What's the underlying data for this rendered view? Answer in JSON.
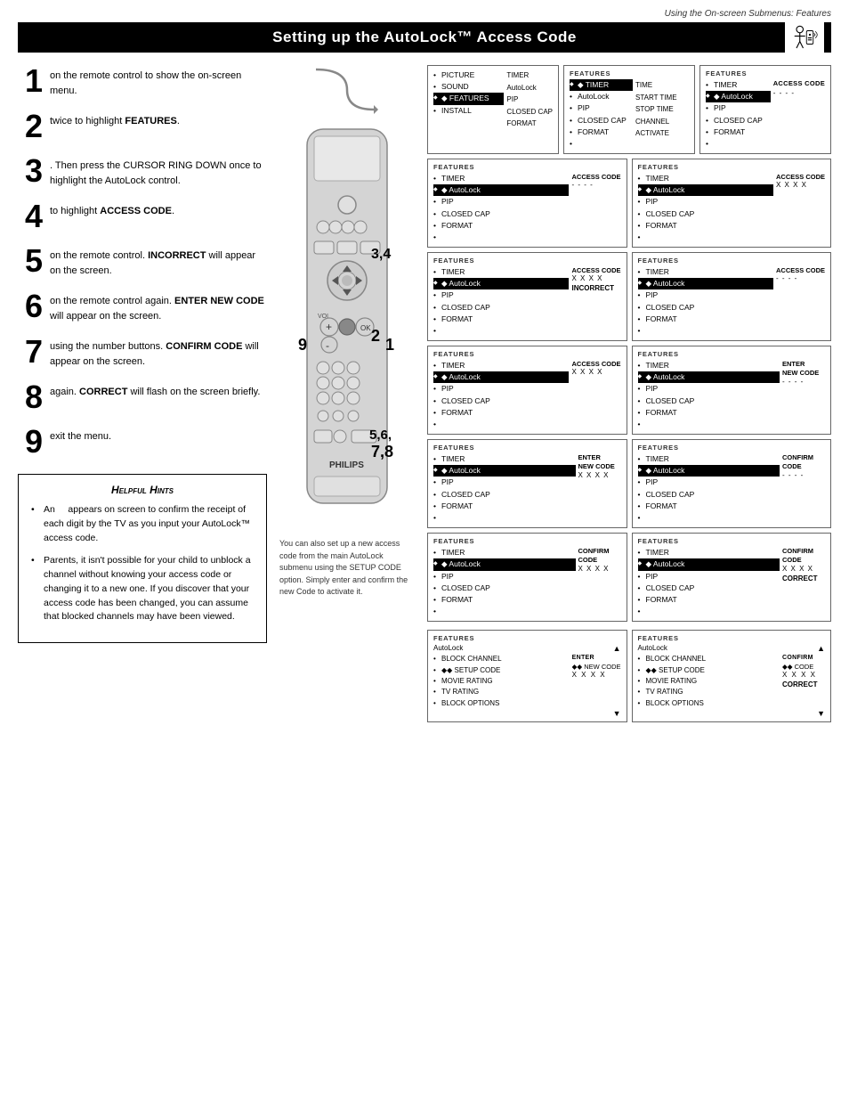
{
  "page": {
    "header_note": "Using the On-screen Submenus: Features",
    "title": "Setting up the AutoLock™ Access Code"
  },
  "steps": [
    {
      "num": "1",
      "text": "on the remote control to show the on-screen menu."
    },
    {
      "num": "2",
      "text": "twice to highlight FEATURES."
    },
    {
      "num": "3",
      "text": ". Then press the CURSOR RING DOWN once to highlight the AutoLock control."
    },
    {
      "num": "4",
      "text": "to highlight ACCESS CODE."
    },
    {
      "num": "5",
      "text": "on the remote control. INCORRECT will appear on the screen."
    },
    {
      "num": "6",
      "text": "on the remote control again. ENTER NEW CODE will appear on the screen."
    },
    {
      "num": "7",
      "text": "using the number buttons. CONFIRM CODE will appear on the screen."
    },
    {
      "num": "8",
      "text": "again. CORRECT will flash on the screen briefly."
    },
    {
      "num": "9",
      "text": "exit the menu."
    }
  ],
  "hints": {
    "title": "Helpful Hints",
    "items": [
      "An      appears on screen to confirm the receipt of each digit by the TV as you input your AutoLock™ access code.",
      "Parents, it isn't possible for your child to unblock a channel without knowing your access code or changing it to a new one. If you discover that your access code has been changed, you can assume that blocked channels may have been viewed."
    ]
  },
  "step_numbers_on_remote": "3,4",
  "step_numbers_mid": "5,6,\n7,8",
  "step_numbers_bottom": "9",
  "step_number_vol": "9",
  "step_number_2": "2",
  "step_number_1": "1",
  "remote_brand": "PHILIPS",
  "bottom_note": "You can also set up a new access code from the main AutoLock submenu using the SETUP CODE option. Simply enter and confirm the new Code to activate it.",
  "menu_panel": {
    "title": "",
    "items": [
      "PICTURE",
      "SOUND",
      "FEATURES",
      "INSTALL"
    ],
    "highlighted_index": 2,
    "right_items": [
      "TIMER",
      "AutoLock",
      "PIP",
      "CLOSED CAP",
      "FORMAT"
    ]
  },
  "panel_rows": [
    {
      "left": {
        "header": "FEATURES",
        "list": [
          "TIMER",
          "AutoLock",
          "PIP",
          "CLOSED CAP",
          "FORMAT",
          ""
        ],
        "highlighted": 0,
        "timer_right_label": "TIME\nSTART TIME\nSTOP TIME\nCHANNEL\nACTIVATE"
      },
      "right": {
        "header": "FEATURES",
        "list": [
          "TIMER",
          "AutoLock",
          "PIP",
          "CLOSED CAP",
          "FORMAT",
          ""
        ],
        "highlighted": 1,
        "aside_label": "ACCESS CODE",
        "aside_val": "- - - -",
        "aside_val_class": "dashes"
      }
    },
    {
      "left": {
        "header": "FEATURES",
        "list": [
          "TIMER",
          "AutoLock",
          "PIP",
          "CLOSED CAP",
          "FORMAT",
          ""
        ],
        "highlighted": 1,
        "aside_label": "ACCESS CODE",
        "aside_val": "- - - -",
        "aside_val_class": "dashes"
      },
      "right": {
        "header": "FEATURES",
        "list": [
          "TIMER",
          "AutoLock",
          "PIP",
          "CLOSED CAP",
          "FORMAT",
          ""
        ],
        "highlighted": 1,
        "aside_label": "ACCESS CODE",
        "aside_val": "X X X X"
      }
    },
    {
      "left": {
        "header": "FEATURES",
        "list": [
          "TIMER",
          "AutoLock",
          "PIP",
          "CLOSED CAP",
          "FORMAT",
          ""
        ],
        "highlighted": 1,
        "aside_label": "ACCESS CODE",
        "aside_val": "X X X X",
        "aside_extra": "INCORRECT"
      },
      "right": {
        "header": "FEATURES",
        "list": [
          "TIMER",
          "AutoLock",
          "PIP",
          "CLOSED CAP",
          "FORMAT",
          ""
        ],
        "highlighted": 1,
        "aside_label": "ACCESS CODE",
        "aside_val": "- - - -",
        "aside_val_class": "dashes"
      }
    },
    {
      "left": {
        "header": "FEATURES",
        "list": [
          "TIMER",
          "AutoLock",
          "PIP",
          "CLOSED CAP",
          "FORMAT",
          ""
        ],
        "highlighted": 1,
        "aside_label": "ACCESS CODE",
        "aside_val": "X X X X"
      },
      "right": {
        "header": "FEATURES",
        "list": [
          "TIMER",
          "AutoLock",
          "PIP",
          "CLOSED CAP",
          "FORMAT",
          ""
        ],
        "highlighted": 1,
        "aside_label": "ENTER\nNEW CODE",
        "aside_val": "- - - -",
        "aside_val_class": "dashes"
      }
    },
    {
      "left": {
        "header": "FEATURES",
        "list": [
          "TIMER",
          "AutoLock",
          "PIP",
          "CLOSED CAP",
          "FORMAT",
          ""
        ],
        "highlighted": 1,
        "aside_label": "ENTER\nNEW CODE",
        "aside_val": "X X X X"
      },
      "right": {
        "header": "FEATURES",
        "list": [
          "TIMER",
          "AutoLock",
          "PIP",
          "CLOSED CAP",
          "FORMAT",
          ""
        ],
        "highlighted": 1,
        "aside_label": "CONFIRM\nCODE",
        "aside_val": "- - - -",
        "aside_val_class": "dashes"
      }
    },
    {
      "left": {
        "header": "FEATURES",
        "list": [
          "TIMER",
          "AutoLock",
          "PIP",
          "CLOSED CAP",
          "FORMAT",
          ""
        ],
        "highlighted": 1,
        "aside_label": "CONFIRM\nCODE",
        "aside_val": "X X X X"
      },
      "right": {
        "header": "FEATURES",
        "list": [
          "TIMER",
          "AutoLock",
          "PIP",
          "CLOSED CAP",
          "FORMAT",
          ""
        ],
        "highlighted": 1,
        "aside_label": "CONFIRM\nCODE",
        "aside_val": "X X X X",
        "aside_extra": "CORRECT"
      }
    }
  ],
  "autolock_panels": [
    {
      "left": {
        "title": "FEATURES",
        "subtitle": "AutoLock",
        "list": [
          "BLOCK CHANNEL",
          "SETUP CODE",
          "MOVIE RATING",
          "TV RATING",
          "BLOCK OPTIONS"
        ],
        "highlighted": [
          1
        ],
        "triangle_top": true,
        "triangle_bottom": true,
        "aside_label": "ENTER",
        "aside_sublabel": "◆◆ NEW CODE",
        "aside_val": "X X X X"
      },
      "right": {
        "title": "FEATURES",
        "subtitle": "AutoLock",
        "list": [
          "BLOCK CHANNEL",
          "SETUP CODE",
          "MOVIE RATING",
          "TV RATING",
          "BLOCK OPTIONS"
        ],
        "highlighted": [
          1
        ],
        "triangle_top": true,
        "triangle_bottom": true,
        "aside_label": "CONFIRM",
        "aside_sublabel": "◆◆ CODE",
        "aside_val": "X X X X",
        "aside_extra": "CORRECT"
      }
    }
  ]
}
